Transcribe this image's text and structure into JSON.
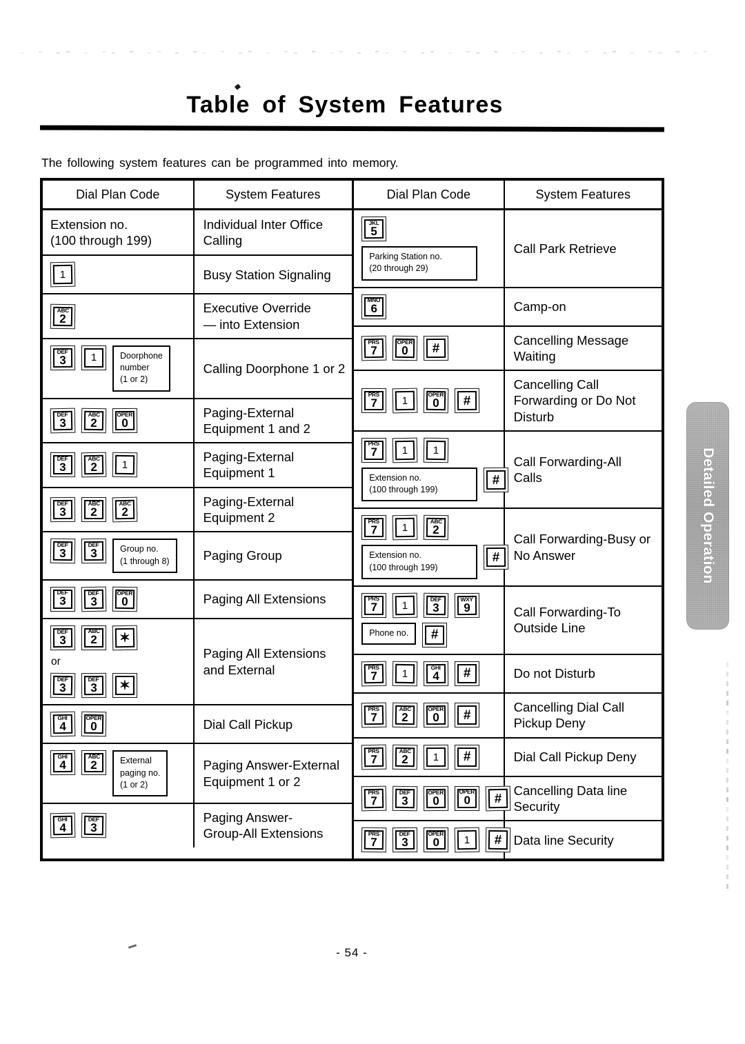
{
  "document": {
    "title": "Table of System Features",
    "intro": "The following system features can be programmed into memory.",
    "page_number": "- 54 -",
    "side_tab_label": "Detailed Operation"
  },
  "table": {
    "headers": {
      "dial_plan_code": "Dial Plan Code",
      "system_features": "System Features"
    },
    "left_rows": [
      {
        "code_text": [
          "Extension no.",
          "(100 through 199)"
        ],
        "keys": [],
        "feature": [
          "Individual Inter Office",
          "Calling"
        ]
      },
      {
        "keys": [
          {
            "type": "key",
            "alpha": "",
            "digit": "1"
          }
        ],
        "feature": [
          "Busy Station Signaling"
        ]
      },
      {
        "keys": [
          {
            "type": "key",
            "alpha": "ABC",
            "digit": "2"
          }
        ],
        "feature": [
          "Executive Override",
          "— into Extension"
        ]
      },
      {
        "keys": [
          {
            "type": "key",
            "alpha": "DEF",
            "digit": "3"
          },
          {
            "type": "key",
            "alpha": "",
            "digit": "1"
          },
          {
            "type": "box",
            "lines": [
              "Doorphone",
              "number",
              "(1 or 2)"
            ]
          }
        ],
        "feature": [
          "Calling Doorphone 1 or 2"
        ]
      },
      {
        "keys": [
          {
            "type": "key",
            "alpha": "DEF",
            "digit": "3"
          },
          {
            "type": "key",
            "alpha": "ABC",
            "digit": "2"
          },
          {
            "type": "key",
            "alpha": "OPER",
            "digit": "0"
          }
        ],
        "feature": [
          "Paging-External",
          "Equipment 1 and 2"
        ]
      },
      {
        "keys": [
          {
            "type": "key",
            "alpha": "DEF",
            "digit": "3"
          },
          {
            "type": "key",
            "alpha": "ABC",
            "digit": "2"
          },
          {
            "type": "key",
            "alpha": "",
            "digit": "1"
          }
        ],
        "feature": [
          "Paging-External",
          "Equipment 1"
        ]
      },
      {
        "keys": [
          {
            "type": "key",
            "alpha": "DEF",
            "digit": "3"
          },
          {
            "type": "key",
            "alpha": "ABC",
            "digit": "2"
          },
          {
            "type": "key",
            "alpha": "ABC",
            "digit": "2"
          }
        ],
        "feature": [
          "Paging-External",
          "Equipment 2"
        ]
      },
      {
        "keys": [
          {
            "type": "key",
            "alpha": "DEF",
            "digit": "3"
          },
          {
            "type": "key",
            "alpha": "DEF",
            "digit": "3"
          },
          {
            "type": "box",
            "lines": [
              "Group no.",
              "(1 through 8)"
            ]
          }
        ],
        "feature": [
          "Paging Group"
        ]
      },
      {
        "keys": [
          {
            "type": "key",
            "alpha": "DEF",
            "digit": "3"
          },
          {
            "type": "key",
            "alpha": "DEF",
            "digit": "3"
          },
          {
            "type": "key",
            "alpha": "OPER",
            "digit": "0"
          }
        ],
        "feature": [
          "Paging All Extensions"
        ]
      },
      {
        "or_label": "or",
        "keys_a": [
          {
            "type": "key",
            "alpha": "DEF",
            "digit": "3"
          },
          {
            "type": "key",
            "alpha": "ABC",
            "digit": "2"
          },
          {
            "type": "key",
            "sym": "✶"
          }
        ],
        "keys_b": [
          {
            "type": "key",
            "alpha": "DEF",
            "digit": "3"
          },
          {
            "type": "key",
            "alpha": "DEF",
            "digit": "3"
          },
          {
            "type": "key",
            "sym": "✶"
          }
        ],
        "feature": [
          "Paging All Extensions",
          "and External"
        ]
      },
      {
        "keys": [
          {
            "type": "key",
            "alpha": "GHI",
            "digit": "4"
          },
          {
            "type": "key",
            "alpha": "OPER",
            "digit": "0"
          }
        ],
        "feature": [
          "Dial Call Pickup"
        ]
      },
      {
        "keys": [
          {
            "type": "key",
            "alpha": "GHI",
            "digit": "4"
          },
          {
            "type": "key",
            "alpha": "ABC",
            "digit": "2"
          },
          {
            "type": "box",
            "lines": [
              "External",
              "paging no.",
              "(1 or 2)"
            ]
          }
        ],
        "feature": [
          "Paging Answer-External",
          "Equipment 1 or 2"
        ]
      },
      {
        "keys": [
          {
            "type": "key",
            "alpha": "GHI",
            "digit": "4"
          },
          {
            "type": "key",
            "alpha": "DEF",
            "digit": "3"
          }
        ],
        "feature": [
          "Paging Answer-",
          "Group-All Extensions"
        ]
      }
    ],
    "right_rows": [
      {
        "keys_a": [
          {
            "type": "key",
            "alpha": "JKL",
            "digit": "5"
          }
        ],
        "keys_b": [
          {
            "type": "box",
            "wide": true,
            "lines": [
              "Parking Station no.",
              "(20 through 29)"
            ]
          }
        ],
        "feature": [
          "Call Park Retrieve"
        ]
      },
      {
        "keys": [
          {
            "type": "key",
            "alpha": "MNO",
            "digit": "6"
          }
        ],
        "feature": [
          "Camp-on"
        ]
      },
      {
        "keys": [
          {
            "type": "key",
            "alpha": "PRS",
            "digit": "7"
          },
          {
            "type": "key",
            "alpha": "OPER",
            "digit": "0"
          },
          {
            "type": "key",
            "sym": "#"
          }
        ],
        "feature": [
          "Cancelling Message",
          "Waiting"
        ]
      },
      {
        "keys": [
          {
            "type": "key",
            "alpha": "PRS",
            "digit": "7"
          },
          {
            "type": "key",
            "alpha": "",
            "digit": "1"
          },
          {
            "type": "key",
            "alpha": "OPER",
            "digit": "0"
          },
          {
            "type": "key",
            "sym": "#"
          }
        ],
        "feature": [
          "Cancelling Call",
          "Forwarding or Do Not",
          "Disturb"
        ]
      },
      {
        "keys_a": [
          {
            "type": "key",
            "alpha": "PRS",
            "digit": "7"
          },
          {
            "type": "key",
            "alpha": "",
            "digit": "1"
          },
          {
            "type": "key",
            "alpha": "",
            "digit": "1"
          }
        ],
        "keys_b": [
          {
            "type": "box",
            "wide": true,
            "lines": [
              "Extension no.",
              "(100 through 199)"
            ]
          },
          {
            "type": "key",
            "sym": "#"
          }
        ],
        "feature": [
          "Call Forwarding-All",
          "Calls"
        ]
      },
      {
        "keys_a": [
          {
            "type": "key",
            "alpha": "PRS",
            "digit": "7"
          },
          {
            "type": "key",
            "alpha": "",
            "digit": "1"
          },
          {
            "type": "key",
            "alpha": "ABC",
            "digit": "2"
          }
        ],
        "keys_b": [
          {
            "type": "box",
            "wide": true,
            "lines": [
              "Extension no.",
              "(100 through 199)"
            ]
          },
          {
            "type": "key",
            "sym": "#"
          }
        ],
        "feature": [
          "Call Forwarding-Busy or",
          "No Answer"
        ]
      },
      {
        "keys_a": [
          {
            "type": "key",
            "alpha": "PRS",
            "digit": "7"
          },
          {
            "type": "key",
            "alpha": "",
            "digit": "1"
          },
          {
            "type": "key",
            "alpha": "DEF",
            "digit": "3"
          },
          {
            "type": "key",
            "alpha": "WXY",
            "digit": "9"
          }
        ],
        "keys_b": [
          {
            "type": "box",
            "lines": [
              "Phone no."
            ]
          },
          {
            "type": "key",
            "sym": "#"
          }
        ],
        "feature": [
          "Call Forwarding-To",
          "Outside Line"
        ]
      },
      {
        "keys": [
          {
            "type": "key",
            "alpha": "PRS",
            "digit": "7"
          },
          {
            "type": "key",
            "alpha": "",
            "digit": "1"
          },
          {
            "type": "key",
            "alpha": "GHI",
            "digit": "4"
          },
          {
            "type": "key",
            "sym": "#"
          }
        ],
        "feature": [
          "Do not Disturb"
        ]
      },
      {
        "keys": [
          {
            "type": "key",
            "alpha": "PRS",
            "digit": "7"
          },
          {
            "type": "key",
            "alpha": "ABC",
            "digit": "2"
          },
          {
            "type": "key",
            "alpha": "OPER",
            "digit": "0"
          },
          {
            "type": "key",
            "sym": "#"
          }
        ],
        "feature": [
          "Cancelling Dial Call",
          "Pickup Deny"
        ]
      },
      {
        "keys": [
          {
            "type": "key",
            "alpha": "PRS",
            "digit": "7"
          },
          {
            "type": "key",
            "alpha": "ABC",
            "digit": "2"
          },
          {
            "type": "key",
            "alpha": "",
            "digit": "1"
          },
          {
            "type": "key",
            "sym": "#"
          }
        ],
        "feature": [
          "Dial Call Pickup Deny"
        ]
      },
      {
        "keys": [
          {
            "type": "key",
            "alpha": "PRS",
            "digit": "7"
          },
          {
            "type": "key",
            "alpha": "DEF",
            "digit": "3"
          },
          {
            "type": "key",
            "alpha": "OPER",
            "digit": "0"
          },
          {
            "type": "key",
            "alpha": "OPER",
            "digit": "0"
          },
          {
            "type": "key",
            "sym": "#"
          }
        ],
        "feature": [
          "Cancelling Data line",
          "Security"
        ]
      },
      {
        "keys": [
          {
            "type": "key",
            "alpha": "PRS",
            "digit": "7"
          },
          {
            "type": "key",
            "alpha": "DEF",
            "digit": "3"
          },
          {
            "type": "key",
            "alpha": "OPER",
            "digit": "0"
          },
          {
            "type": "key",
            "alpha": "",
            "digit": "1"
          },
          {
            "type": "key",
            "sym": "#"
          }
        ],
        "feature": [
          "Data line Security"
        ]
      }
    ]
  }
}
